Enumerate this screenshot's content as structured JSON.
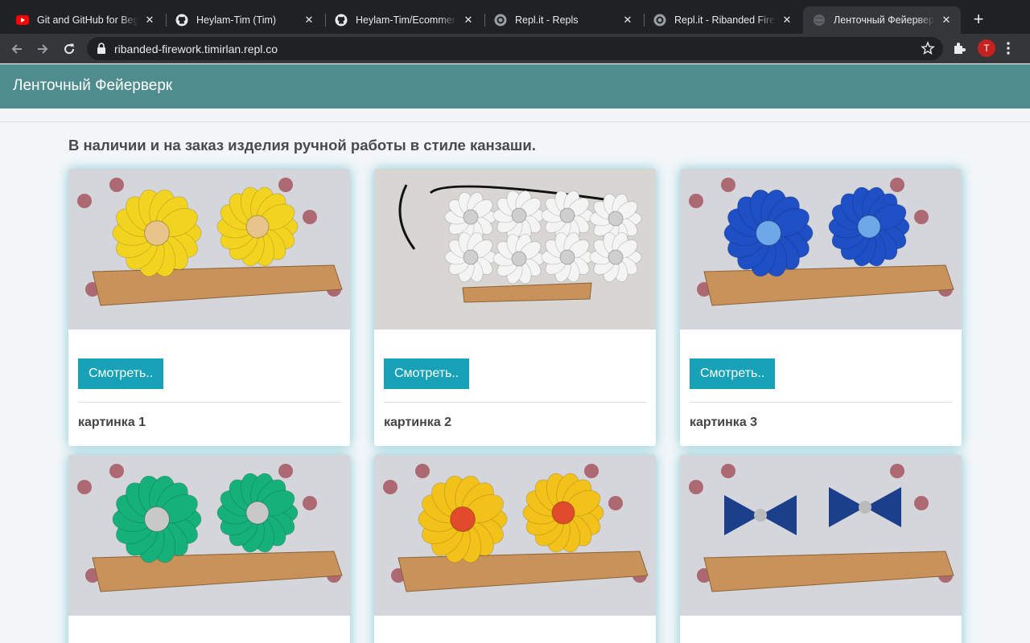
{
  "browser": {
    "tabs": [
      {
        "title": "Git and GitHub for Beginners",
        "icon": "youtube-icon"
      },
      {
        "title": "Heylam-Tim (Tim)",
        "icon": "github-icon"
      },
      {
        "title": "Heylam-Tim/Ecommerce",
        "icon": "github-icon"
      },
      {
        "title": "Repl.it - Repls",
        "icon": "replit-icon"
      },
      {
        "title": "Repl.it - Ribanded Firework",
        "icon": "replit-icon"
      },
      {
        "title": "Ленточный Фейерверк",
        "icon": "globe-icon"
      }
    ],
    "url": "ribanded-firework.timirlan.repl.co",
    "profile_initial": "T"
  },
  "site": {
    "brand": "Ленточный Фейерверк",
    "lead": "В наличии и на заказ изделия ручной работы в стиле канзаши."
  },
  "cards": [
    {
      "button": "Смотреть..",
      "caption": "картинка 1",
      "flower_color": "#f2d320",
      "center_color": "#e6c48a"
    },
    {
      "button": "Смотреть..",
      "caption": "картинка 2",
      "flower_color": "#f4f4f4",
      "center_color": "#cfcfcf"
    },
    {
      "button": "Смотреть..",
      "caption": "картинка 3",
      "flower_color": "#1f4fc4",
      "center_color": "#6fa8e8"
    },
    {
      "button": "",
      "caption": "",
      "flower_color": "#16b07a",
      "center_color": "#c8c8c8"
    },
    {
      "button": "",
      "caption": "",
      "flower_color": "#f2c21a",
      "center_color": "#e14a2a"
    },
    {
      "button": "",
      "caption": "",
      "flower_color": "#1c3f8c",
      "center_color": "#bbbbbb"
    }
  ],
  "colors": {
    "header": "#4e8c8d",
    "button": "#17a2b8",
    "ruler": "#c9925a"
  }
}
